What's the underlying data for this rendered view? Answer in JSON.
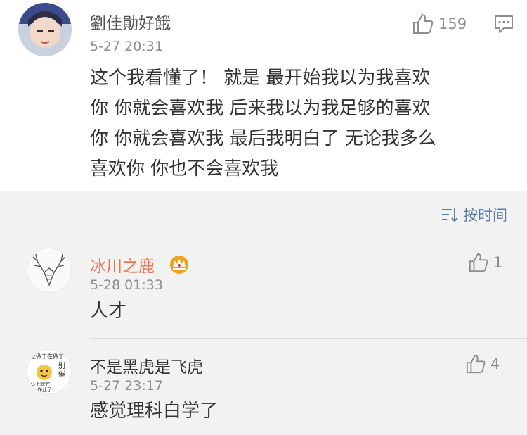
{
  "comments": [
    {
      "username": "劉佳勛好餓",
      "timestamp": "5-27 20:31",
      "likes": "159",
      "text_lines": [
        "这个我看懂了！   就是 最开始我以为我喜欢",
        "你 你就会喜欢我 后来我以为我足够的喜欢",
        "你 你就会喜欢我 最后我明白了 无论我多么",
        "喜欢你 你也不会喜欢我"
      ]
    },
    {
      "username": "冰川之鹿",
      "timestamp": "5-28 01:33",
      "likes": "1",
      "text": "人才"
    },
    {
      "username": "不是黑虎是飞虎",
      "timestamp": "5-27 23:17",
      "likes": "4",
      "text": "感觉理科白学了",
      "avatar_text": [
        "正做了在做了",
        "别",
        "催",
        "马上就完",
        "作业了！"
      ]
    }
  ],
  "sort": {
    "label": "按时间"
  },
  "colors": {
    "accent_name": "#eb7350",
    "link_blue": "#5a7fa6",
    "crown_gold": "#f0a21b"
  },
  "icons": {
    "like": "thumbs-up-icon",
    "reply": "comment-icon",
    "sort": "sort-icon",
    "vip": "crown-badge-icon"
  }
}
